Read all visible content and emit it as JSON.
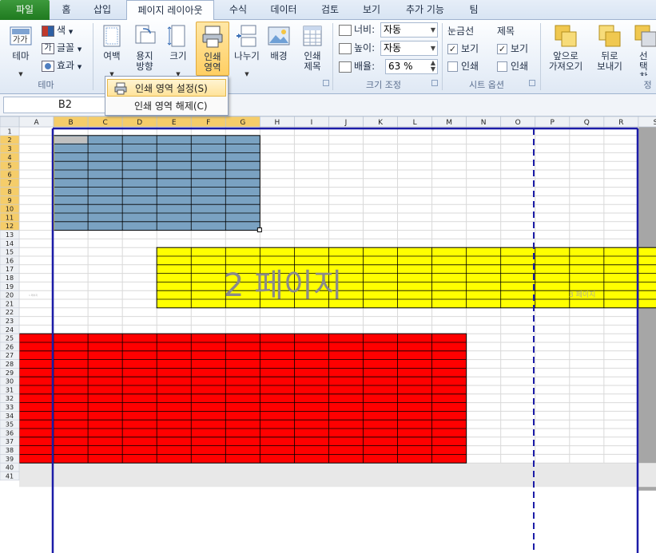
{
  "tabs": [
    {
      "label": "파일",
      "kind": "file"
    },
    {
      "label": "홈"
    },
    {
      "label": "삽입"
    },
    {
      "label": "페이지 레이아웃",
      "active": true
    },
    {
      "label": "수식"
    },
    {
      "label": "데이터"
    },
    {
      "label": "검토"
    },
    {
      "label": "보기"
    },
    {
      "label": "추가 기능"
    },
    {
      "label": "팀"
    }
  ],
  "ribbon": {
    "theme": {
      "theme_label": "테마",
      "colors_label": "색",
      "fonts_label": "글꼴",
      "effects_label": "효과",
      "group_label": "테마"
    },
    "page_setup": {
      "margins_label": "여백",
      "orientation_label": "용지\n방향",
      "size_label": "크기",
      "print_area_label": "인쇄\n영역",
      "breaks_label": "나누기",
      "background_label": "배경",
      "print_titles_label": "인쇄\n제목"
    },
    "scale": {
      "width_label": "너비:",
      "width_value": "자동",
      "height_label": "높이:",
      "height_value": "자동",
      "scale_label": "배율:",
      "scale_value": "63 %",
      "group_label": "크기 조정"
    },
    "sheet_options": {
      "gridlines_label": "눈금선",
      "headings_label": "제목",
      "view_label": "보기",
      "print_label": "인쇄",
      "gridlines_view": true,
      "gridlines_print": false,
      "headings_view": true,
      "headings_print": false,
      "group_label": "시트 옵션"
    },
    "arrange": {
      "bring_forward_label": "앞으로\n가져오기",
      "send_backward_label": "뒤로\n보내기",
      "selection_pane_label": "선택\n창",
      "group_label": "정"
    }
  },
  "menu": {
    "items": [
      {
        "label": "인쇄 영역 설정(S)",
        "highlighted": true
      },
      {
        "label": "인쇄 영역 해제(C)",
        "highlighted": false
      }
    ]
  },
  "namebox": {
    "value": "B2"
  },
  "grid": {
    "columns": [
      "A",
      "B",
      "C",
      "D",
      "E",
      "F",
      "G",
      "H",
      "I",
      "J",
      "K",
      "L",
      "M",
      "N",
      "O",
      "P",
      "Q",
      "R",
      "S"
    ],
    "selected_columns": [
      "B",
      "C",
      "D",
      "E",
      "F",
      "G"
    ],
    "rows": [
      1,
      2,
      3,
      4,
      5,
      6,
      7,
      8,
      9,
      10,
      11,
      12,
      13,
      14,
      15,
      16,
      17,
      18,
      19,
      20,
      21,
      22,
      23,
      24,
      25,
      26,
      27,
      28,
      29,
      30,
      31,
      32,
      33,
      34,
      35,
      36,
      37,
      38,
      39,
      40,
      41
    ],
    "selected_rows": [
      2,
      3,
      4,
      5,
      6,
      7,
      8,
      9,
      10,
      11,
      12
    ],
    "page2_watermark": "2 페이지",
    "page3_watermark": "3 페이지",
    "page1_watermark": "1 페이지",
    "colors": {
      "blue_fill": "#7aa2c2",
      "yellow_fill": "#ffff00",
      "red_fill": "#ff0000",
      "page_break": "#1c1ca8"
    }
  }
}
